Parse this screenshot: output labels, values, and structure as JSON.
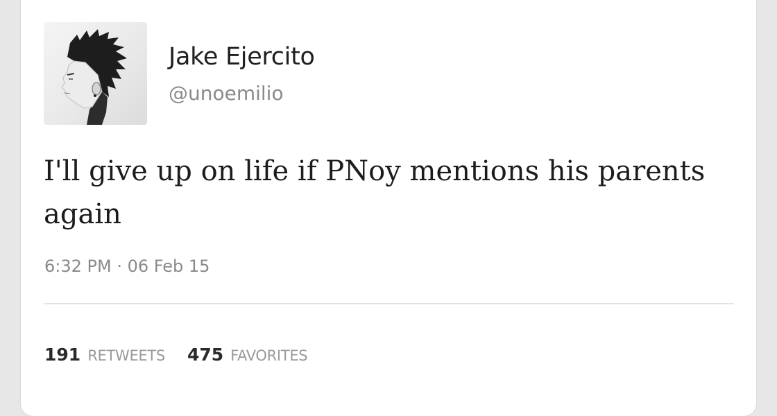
{
  "tweet": {
    "author": {
      "display_name": "Jake Ejercito",
      "handle": "@unoemilio",
      "avatar_icon": "profile-photo"
    },
    "text": "I'll give up on life if PNoy mentions his parents again",
    "timestamp": "6:32 PM · 06 Feb 15",
    "stats": {
      "retweets_count": "191",
      "retweets_label": "RETWEETS",
      "favorites_count": "475",
      "favorites_label": "FAVORITES"
    }
  },
  "colors": {
    "background": "#e7e7e7",
    "card": "#ffffff",
    "text_primary": "#1c1c1c",
    "text_secondary": "#8a8a8a"
  }
}
